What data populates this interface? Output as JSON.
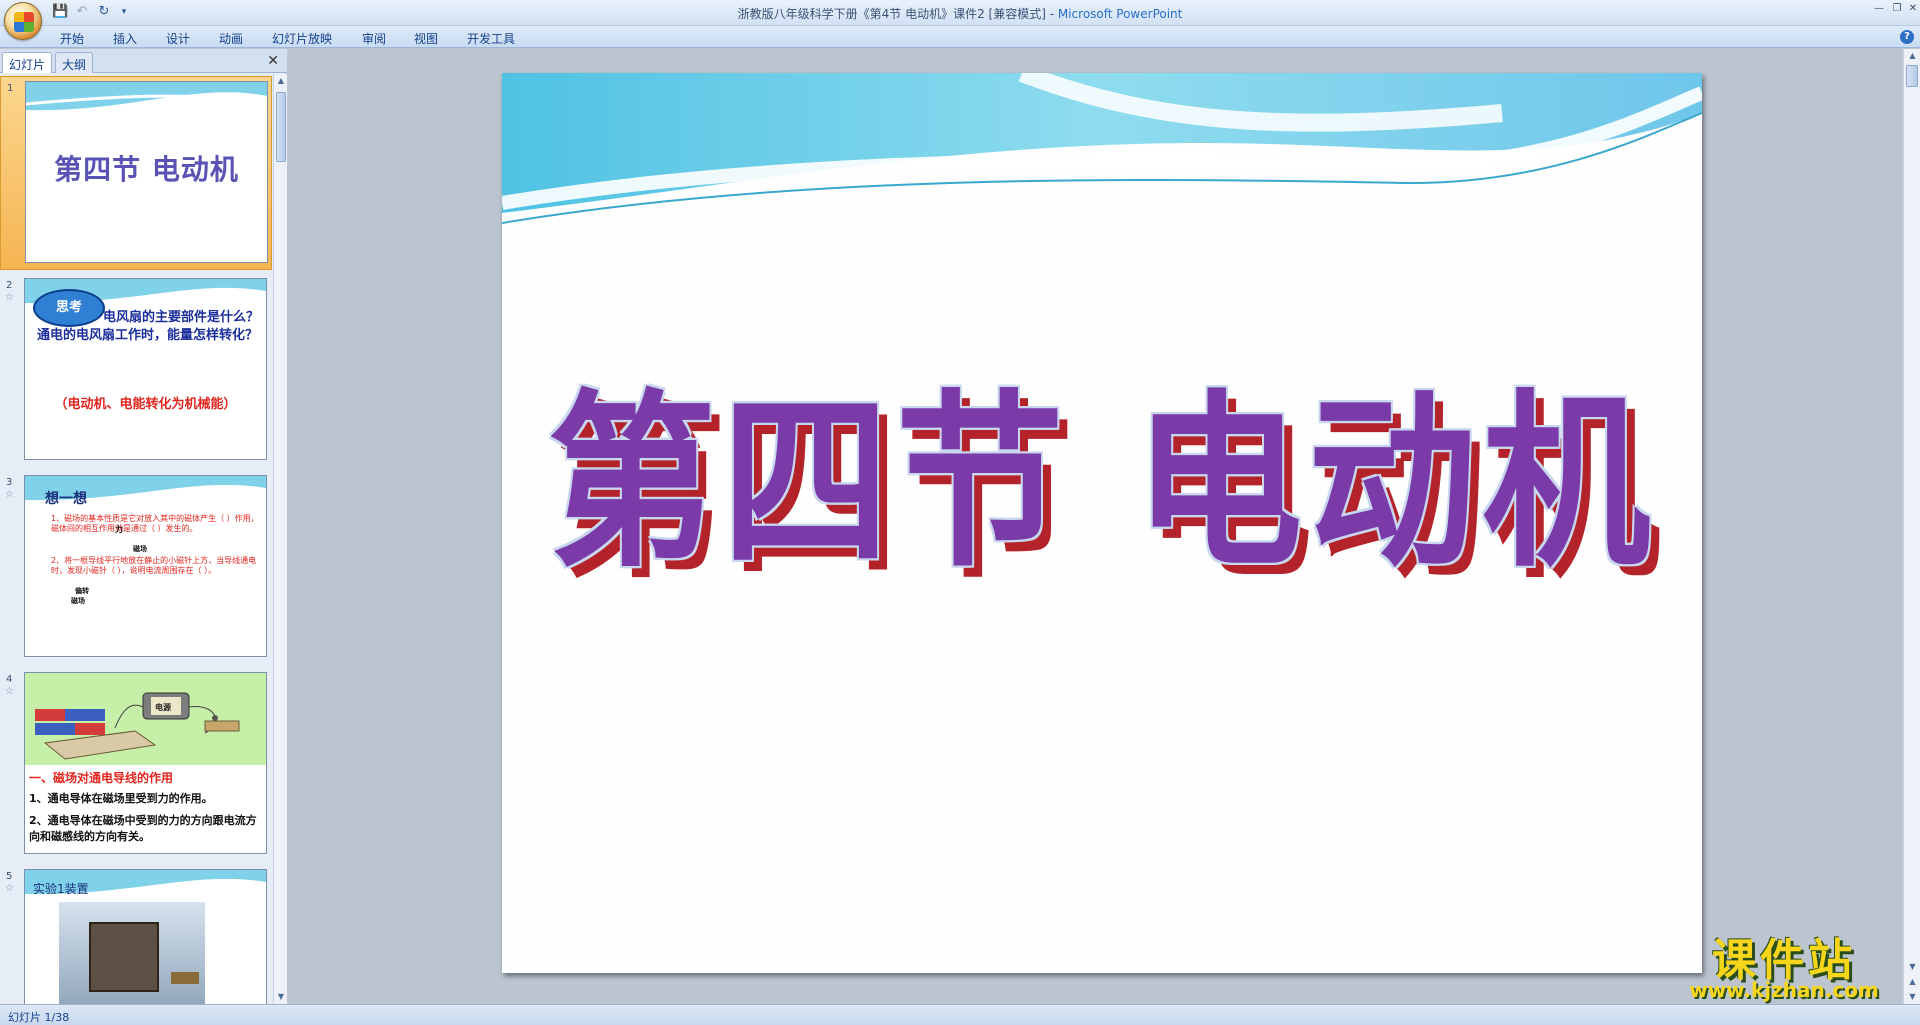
{
  "window": {
    "title": "浙教版八年级科学下册《第4节 电动机》课件2 [兼容模式] - ",
    "app_name": "Microsoft PowerPoint"
  },
  "ribbon": {
    "tabs": [
      "开始",
      "插入",
      "设计",
      "动画",
      "幻灯片放映",
      "审阅",
      "视图",
      "开发工具"
    ]
  },
  "pane": {
    "tab_slides": "幻灯片",
    "tab_outline": "大纲"
  },
  "thumbnails": [
    {
      "num": "1",
      "title": "第四节  电动机"
    },
    {
      "num": "2",
      "badge": "思考",
      "question": "电风扇的主要部件是什么？通电的电风扇工作时，能量怎样转化？",
      "answer": "（电动机、电能转化为机械能）"
    },
    {
      "num": "3",
      "heading": "想一想",
      "line1": "1、磁场的基本性质是它对放入其中的磁体产生（  ）作用，磁体间的相互作用就是通过（      ）发生的。",
      "ans1": "力",
      "ans2": "磁场",
      "line2": "2、将一根导线平行地放在静止的小磁针上方，当导线通电时，发现小磁针（      ），说明电流周围存在（      ）。",
      "ans3": "偏转",
      "ans4": "磁场"
    },
    {
      "num": "4",
      "label_power": "电源",
      "heading": "一、磁场对通电导线的作用",
      "line1": "1、通电导体在磁场里受到力的作用。",
      "line2": "2、通电导体在磁场中受到的力的方向跟电流方向和磁感线的方向有关。"
    },
    {
      "num": "5",
      "heading": "实验1装置"
    }
  ],
  "slide": {
    "title": "第四节  电动机"
  },
  "status": {
    "slide_info": "幻灯片 1/38"
  },
  "watermark": {
    "brand": "课件站",
    "url": "www.kjzhan.com"
  }
}
